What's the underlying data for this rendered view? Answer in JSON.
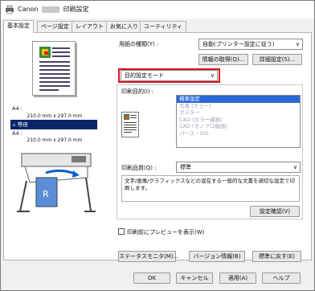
{
  "window": {
    "title_prefix": "Canon",
    "title_suffix": "印刷設定"
  },
  "tabs": [
    {
      "label": "基本設定",
      "active": true
    },
    {
      "label": "ページ設定",
      "active": false
    },
    {
      "label": "レイアウト",
      "active": false
    },
    {
      "label": "お気に入り",
      "active": false
    },
    {
      "label": "ユーティリティ",
      "active": false
    }
  ],
  "preview": {
    "size_rows": [
      {
        "label": "A4 :",
        "value": "210.0 mm x 297.0 mm"
      },
      {
        "label": "等倍",
        "value": ""
      },
      {
        "label": "A4 :",
        "value": "210.0 mm x 297.0 mm"
      }
    ]
  },
  "media": {
    "label": "用紙の種類(Y) :",
    "value": "自動(プリンター設定に従う)",
    "get_info_button": "情報の取得(Q)...",
    "details_button": "詳細設定(S)..."
  },
  "mode": {
    "value": "目的設定モード"
  },
  "purpose": {
    "label": "印刷目的(I) :",
    "items": [
      {
        "label": "標準設定",
        "selected": true
      },
      {
        "label": "写真 (カラー)",
        "selected": false
      },
      {
        "label": "ポスター",
        "selected": false
      },
      {
        "label": "CAD (カラー線画)",
        "selected": false
      },
      {
        "label": "CAD (モノクロ線画)",
        "selected": false
      },
      {
        "label": "パース・GIS",
        "selected": false
      }
    ]
  },
  "quality": {
    "label": "印刷品質(Q) :",
    "value": "標準",
    "description": "文字/画像/グラフィックスなどの混在する一般的な文書を適切な設定で印刷します。",
    "confirm_button": "設定確認(V)"
  },
  "preview_checkbox": {
    "label": "印刷前にプレビューを表示(W)",
    "checked": false
  },
  "bottom_buttons": {
    "status": "ステータスモニタ(M)...",
    "version": "バージョン情報(B)",
    "default": "標準に戻す(E)"
  },
  "dialog_buttons": {
    "ok": "OK",
    "cancel": "キャンセル",
    "apply": "適用(A)",
    "help": "ヘルプ"
  }
}
